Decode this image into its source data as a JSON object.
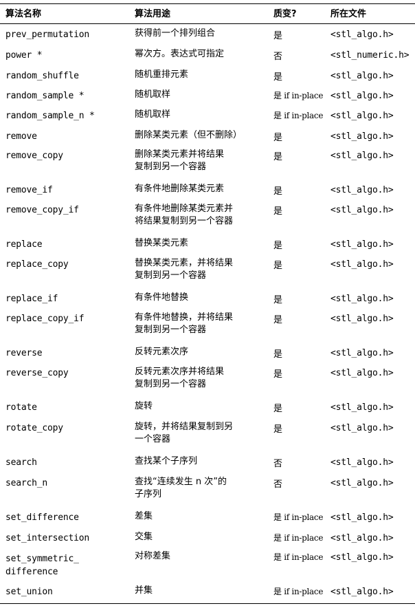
{
  "header": {
    "col1": "算法名称",
    "col2": "算法用途",
    "col3": "质变?",
    "col4": "所在文件"
  },
  "rows": [
    {
      "name": "prev_permutation",
      "purpose": "获得前一个排列组合",
      "mutating": "是",
      "file": "<stl_algo.h>"
    },
    {
      "name": "power *",
      "purpose": "幂次方。表达式可指定",
      "mutating": "否",
      "file": "<stl_numeric.h>"
    },
    {
      "name": "random_shuffle",
      "purpose": "随机重排元素",
      "mutating": "是",
      "file": "<stl_algo.h>"
    },
    {
      "name": "random_sample *",
      "purpose": "随机取样",
      "mutating": "是 if in-place",
      "file": "<stl_algo.h>"
    },
    {
      "name": "random_sample_n *",
      "purpose": "随机取样",
      "mutating": "是 if in-place",
      "file": "<stl_algo.h>"
    },
    {
      "name": "remove",
      "purpose": "删除某类元素（但不删除）",
      "mutating": "是",
      "file": "<stl_algo.h>"
    },
    {
      "name": "remove_copy",
      "purpose": "删除某类元素并将结果\n复制到另一个容器",
      "mutating": "是",
      "file": "<stl_algo.h>"
    },
    {
      "name": "remove_if",
      "purpose": "有条件地删除某类元素",
      "mutating": "是",
      "file": "<stl_algo.h>"
    },
    {
      "name": "remove_copy_if",
      "purpose": "有条件地删除某类元素并\n将结果复制到另一个容器",
      "mutating": "是",
      "file": "<stl_algo.h>"
    },
    {
      "name": "replace",
      "purpose": "替换某类元素",
      "mutating": "是",
      "file": "<stl_algo.h>"
    },
    {
      "name": "replace_copy",
      "purpose": "替换某类元素，并将结果\n复制到另一个容器",
      "mutating": "是",
      "file": "<stl_algo.h>"
    },
    {
      "name": "replace_if",
      "purpose": "有条件地替换",
      "mutating": "是",
      "file": "<stl_algo.h>"
    },
    {
      "name": "replace_copy_if",
      "purpose": "有条件地替换，并将结果\n复制到另一个容器",
      "mutating": "是",
      "file": "<stl_algo.h>"
    },
    {
      "name": "reverse",
      "purpose": "反转元素次序",
      "mutating": "是",
      "file": "<stl_algo.h>"
    },
    {
      "name": "reverse_copy",
      "purpose": "反转元素次序并将结果\n复制到另一个容器",
      "mutating": "是",
      "file": "<stl_algo.h>"
    },
    {
      "name": "rotate",
      "purpose": "旋转",
      "mutating": "是",
      "file": "<stl_algo.h>"
    },
    {
      "name": "rotate_copy",
      "purpose": "旋转，并将结果复制到另\n一个容器",
      "mutating": "是",
      "file": "<stl_algo.h>"
    },
    {
      "name": "search",
      "purpose": "查找某个子序列",
      "mutating": "否",
      "file": "<stl_algo.h>"
    },
    {
      "name": "search_n",
      "purpose": "查找“连续发生 n 次”的\n子序列",
      "mutating": "否",
      "file": "<stl_algo.h>"
    },
    {
      "name": "set_difference",
      "purpose": "差集",
      "mutating": "是 if in-place",
      "file": "<stl_algo.h>"
    },
    {
      "name": "set_intersection",
      "purpose": "交集",
      "mutating": "是 if in-place",
      "file": "<stl_algo.h>"
    },
    {
      "name": "set_symmetric_\ndifference",
      "purpose": "对称差集",
      "mutating": "是 if in-place",
      "file": "<stl_algo.h>"
    },
    {
      "name": "set_union",
      "purpose": "并集",
      "mutating": "是 if in-place",
      "file": "<stl_algo.h>"
    }
  ]
}
